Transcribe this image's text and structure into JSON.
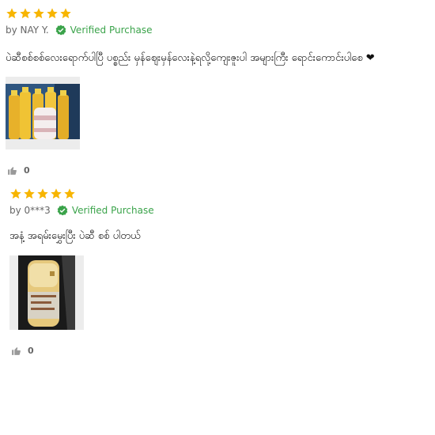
{
  "colors": {
    "star": "#f7b500",
    "verified": "#3aa34a",
    "meta": "#666666"
  },
  "reviews": [
    {
      "rating": 5,
      "author": "by NAY Y.",
      "verified_label": "Verified Purchase",
      "content": "ပဲဆီစစ်စစ်လေးရောက်ပါပြီ ပစ္စည်း မှန်ဈေးမှန်လေးနဲ့ရလို့ကျေးဇူးပါ အများကြီး ရောင်းကောင်းပါစေ ❤",
      "photo_icon": "product-photo-oil-bottles",
      "likes": "0"
    },
    {
      "rating": 5,
      "author": "by 0***3",
      "verified_label": "Verified Purchase",
      "content": "အနံ့ အရမ်းမွှေးပြီး ပဲဆီ စစ် ပါတယ်",
      "photo_icon": "product-photo-bottle",
      "likes": "0"
    }
  ]
}
